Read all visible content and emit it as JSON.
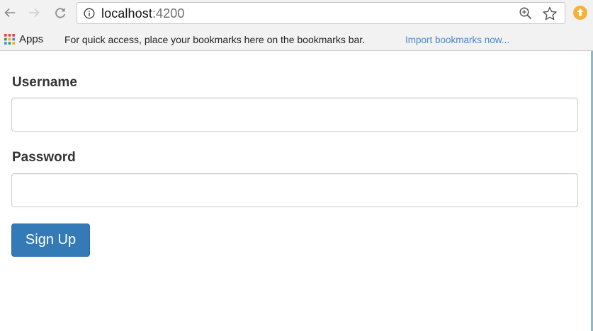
{
  "browser": {
    "url_host": "localhost",
    "url_port": ":4200",
    "icons": [
      "back-arrow-icon",
      "forward-arrow-icon",
      "reload-icon",
      "info-icon",
      "zoom-icon",
      "star-icon",
      "extension-icon"
    ]
  },
  "bookmarks_bar": {
    "apps_label": "Apps",
    "hint": "For quick access, place your bookmarks here on the bookmarks bar.",
    "import_link": "Import bookmarks now..."
  },
  "form": {
    "username_label": "Username",
    "username_value": "",
    "password_label": "Password",
    "password_value": "",
    "submit_label": "Sign Up"
  },
  "colors": {
    "button_primary": "#337ab7",
    "link": "#4a86c8"
  }
}
